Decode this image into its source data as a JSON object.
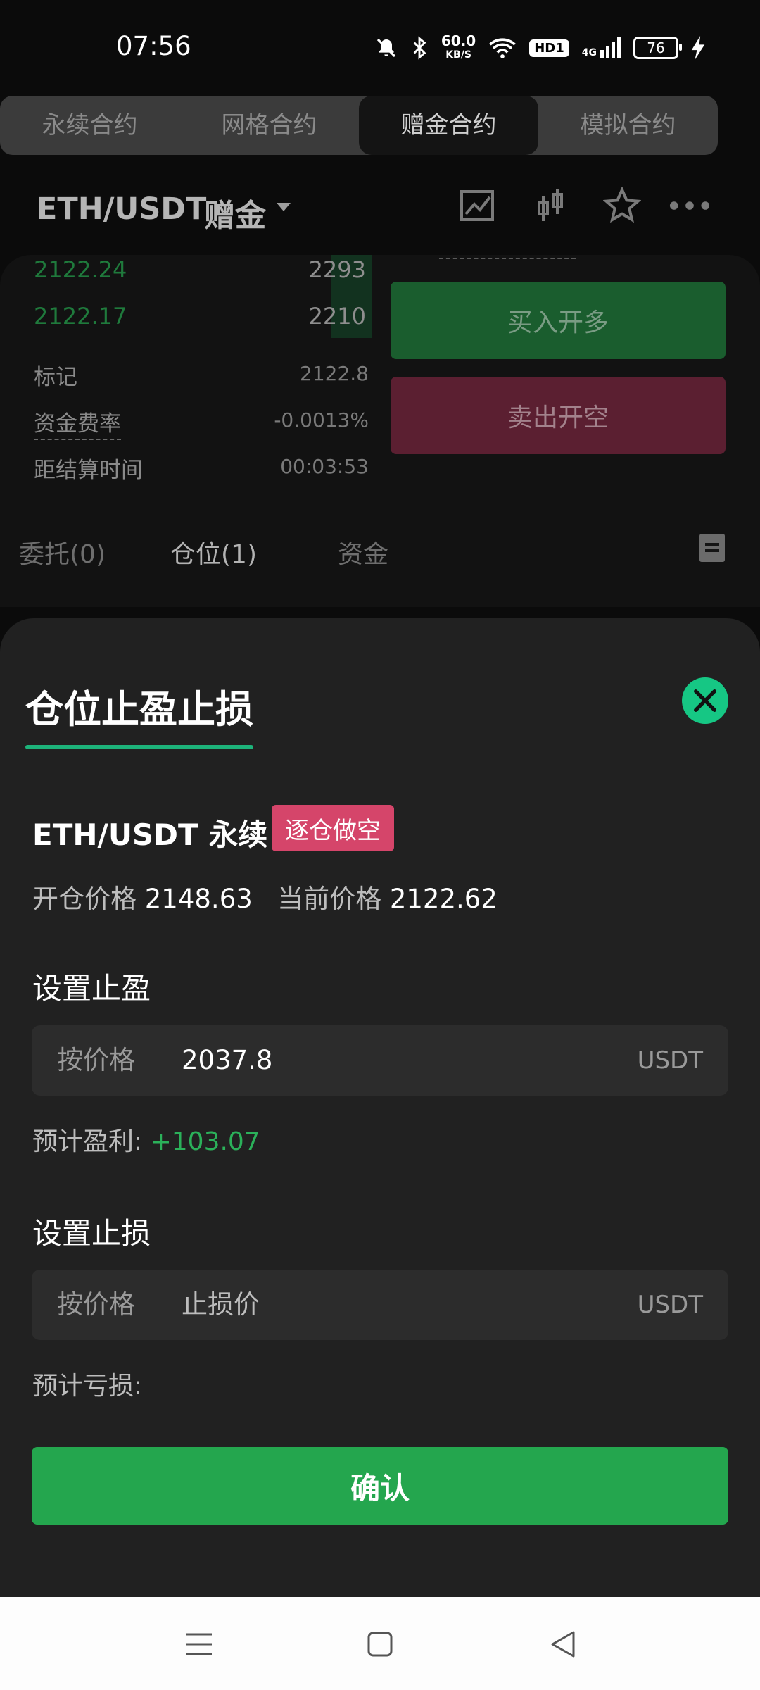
{
  "status_bar": {
    "time": "07:56",
    "net_speed": "60.0",
    "net_unit": "KB/S",
    "hd": "HD1",
    "signal": "4G",
    "battery": "76"
  },
  "contract_tabs": [
    "永续合约",
    "网格合约",
    "赠金合约",
    "模拟合约"
  ],
  "header": {
    "pair": "ETH/USDT",
    "type": "赠金",
    "icons": [
      "chart-line-icon",
      "candlestick-icon",
      "star-icon",
      "more-icon"
    ]
  },
  "order_book": [
    {
      "price": "2122.24",
      "qty": "2293"
    },
    {
      "price": "2122.17",
      "qty": "2210"
    }
  ],
  "market_info": {
    "mark_label": "标记",
    "mark_value": "2122.8",
    "funding_label": "资金费率",
    "funding_value": "-0.0013%",
    "settle_label": "距结算时间",
    "settle_value": "00:03:53"
  },
  "trade_buttons": {
    "buy": "买入开多",
    "sell": "卖出开空"
  },
  "position_tabs": [
    "委托(0)",
    "仓位(1)",
    "资金"
  ],
  "sheet": {
    "title": "仓位止盈止损",
    "pair": "ETH/USDT 永续",
    "badge": "逐仓做空",
    "open_price_label": "开仓价格",
    "open_price": "2148.63",
    "current_price_label": "当前价格",
    "current_price": "2122.62",
    "take_profit": {
      "title": "设置止盈",
      "mode": "按价格",
      "value": "2037.8",
      "unit": "USDT",
      "est_label": "预计盈利:",
      "est_value": "+103.07"
    },
    "stop_loss": {
      "title": "设置止损",
      "mode": "按价格",
      "placeholder": "止损价",
      "unit": "USDT",
      "est_label": "预计亏损:"
    },
    "confirm": "确认"
  },
  "colors": {
    "green": "#24a64e",
    "accent": "#16c784",
    "short_badge": "#d5456a",
    "profit": "#2bb15a"
  }
}
